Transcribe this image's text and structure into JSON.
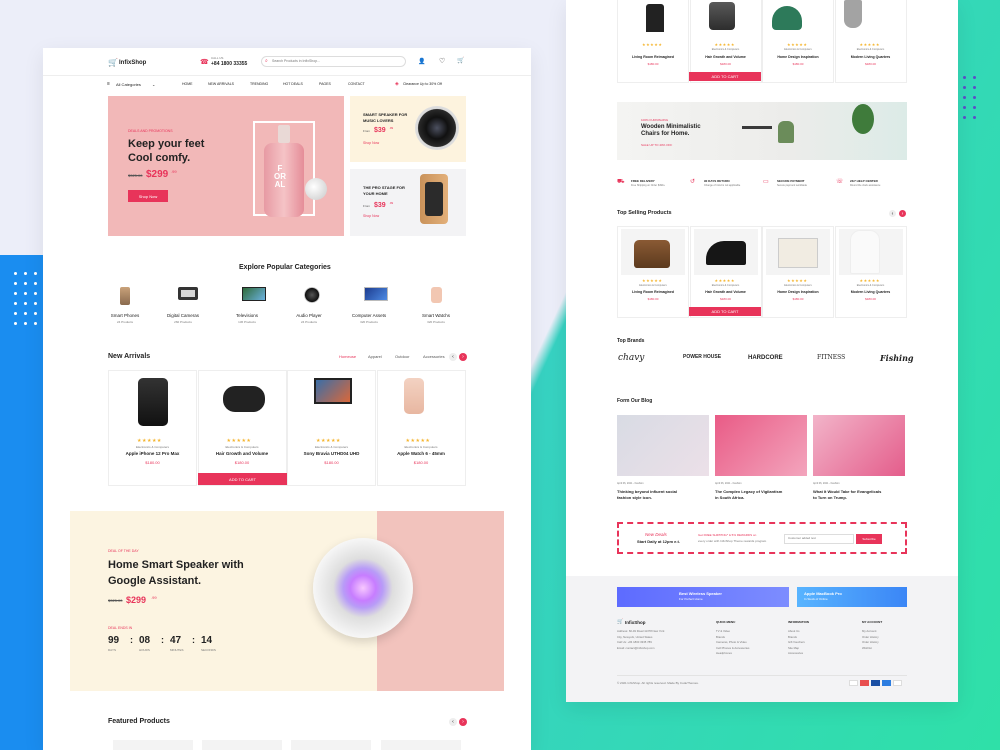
{
  "brand": "InfixShop",
  "header": {
    "call_label": "CALL US",
    "phone": "+84 1800 33355",
    "search_placeholder": "Search Products in InfixShop..."
  },
  "nav": {
    "categories": "All Categories",
    "items": [
      "HOME",
      "NEW ARRIVALS",
      "TRENDING",
      "HOT DEALS",
      "PAGES",
      "CONTACT"
    ],
    "promo": "Clearance Up to 30% Off"
  },
  "hero": {
    "kicker": "DEALS AND PROMOTIONS",
    "title1": "Keep your feet",
    "title2": "Cool comfy.",
    "old_price": "$325.00",
    "price": "$299",
    "cents": ".99",
    "cta": "Shop Now",
    "bottle_text": "F\nOR\nAL"
  },
  "side_banners": [
    {
      "title1": "SMART SPEAKER FOR",
      "title2": "MUSIC LOVERS",
      "from": "From",
      "price": "$39",
      "cents": ".99",
      "cta": "Shop Now"
    },
    {
      "title1": "THE PRO STAGE FOR",
      "title2": "YOUR HOME",
      "from": "From",
      "price": "$39",
      "cents": ".99",
      "cta": "Shop Now"
    }
  ],
  "categories": {
    "title": "Explore Popular Categories",
    "items": [
      {
        "name": "Smart Phones",
        "count": "24 Products",
        "icon": "phone-icon"
      },
      {
        "name": "Digital Cameras",
        "count": "260 Products",
        "icon": "camera-icon"
      },
      {
        "name": "Televisions",
        "count": "136 Products",
        "icon": "tv-icon"
      },
      {
        "name": "Audio Player",
        "count": "24 Products",
        "icon": "speaker-icon"
      },
      {
        "name": "Computer Assets",
        "count": "320 Products",
        "icon": "laptop-icon"
      },
      {
        "name": "Smart Watchs",
        "count": "320 Products",
        "icon": "watch-icon"
      }
    ]
  },
  "new_arrivals": {
    "title": "New Arrivals",
    "tabs": [
      "Homeuse",
      "Apparel",
      "Outdoor",
      "Accessories"
    ],
    "add_to_cart": "ADD TO CART",
    "items": [
      {
        "cat": "Electronics & Computers",
        "name": "Apple iPhone 12 Pro Max",
        "price": "$180.00",
        "icon": "iphone-image"
      },
      {
        "cat": "Electronics & Computers",
        "name": "Hair Growth and Volume",
        "price": "$180.00",
        "icon": "gamepad-image"
      },
      {
        "cat": "Electronics & Computers",
        "name": "Sony Bravia UTHD04 UHD",
        "price": "$180.00",
        "icon": "tv-image"
      },
      {
        "cat": "Electronics & Computers",
        "name": "Apple Watch 6 - 45mm",
        "price": "$180.00",
        "icon": "watch-image"
      }
    ]
  },
  "deal": {
    "kicker": "DEAL OF THE DAY",
    "title1": "Home Smart Speaker with",
    "title2": "Google Assistant.",
    "old_price": "$325.00",
    "price": "$299",
    "cents": ".99",
    "ends": "DEAL ENDS IN",
    "timer": [
      {
        "v": "99",
        "l": "DAYS"
      },
      {
        "v": "08",
        "l": "HOURS"
      },
      {
        "v": "47",
        "l": "MINUTES"
      },
      {
        "v": "14",
        "l": "SECONDS"
      }
    ]
  },
  "featured": {
    "title": "Featured Products"
  },
  "p2_top": {
    "add_to_cart": "ADD TO CART",
    "items": [
      {
        "cat": "",
        "name": "Living Room Reimagined",
        "price": "$180.00"
      },
      {
        "cat": "Electronics & Computers",
        "name": "Hair Growth and Volume",
        "price": "$180.00"
      },
      {
        "cat": "Electronics & Computers",
        "name": "Home Design Inspiration",
        "price": "$180.00"
      },
      {
        "cat": "Electronics & Computers",
        "name": "Modern Living Quarters",
        "price": "$180.00"
      }
    ]
  },
  "chairs": {
    "kicker": "100% FURNISHING",
    "title1": "Wooden Minimalistic",
    "title2": "Chairs for Home.",
    "sub": "SALE UP TO 40% OFF"
  },
  "features": [
    {
      "title": "FREE DELIVERY",
      "sub": "Free Shipping on Order $499+"
    },
    {
      "title": "90 DAYS RETURN",
      "sub": "Change of mind is not applicable"
    },
    {
      "title": "SECURE PAYMENT",
      "sub": "Secure payment worldwide"
    },
    {
      "title": "24/7 HELP CENTER",
      "sub": "Round the clock assistance"
    }
  ],
  "top_selling": {
    "title": "Top Selling Products",
    "add_to_cart": "ADD TO CART",
    "items": [
      {
        "cat": "Electronics & Computers",
        "name": "Living Room Reimagined",
        "price": "$180.00"
      },
      {
        "cat": "Electronics & Computers",
        "name": "Hair Growth and Volume",
        "price": "$180.00"
      },
      {
        "cat": "Electronics & Computers",
        "name": "Home Design Inspiration",
        "price": "$180.00"
      },
      {
        "cat": "Electronics & Computers",
        "name": "Modern Living Quarters",
        "price": "$180.00"
      }
    ]
  },
  "brands": {
    "title": "Top Brands",
    "items": [
      "chavy",
      "POWER HOUSE",
      "HARDCORE",
      "FITNESS",
      "Fishing"
    ]
  },
  "blog": {
    "title": "Form Our Blog",
    "items": [
      {
        "date": "April 06, 2021 - Fashion",
        "t1": "Thinking beyond influent social",
        "t2": "fashion style icon."
      },
      {
        "date": "April 06, 2021 - Fashion",
        "t1": "The Complex Legacy of Vigilantism",
        "t2": "in South Africa."
      },
      {
        "date": "April 06, 2021 - Fashion",
        "t1": "What It Would Take for Evangelicals",
        "t2": "to Turn on Trump."
      }
    ]
  },
  "newsletter": {
    "kicker": "New Deals",
    "sub": "Start Daily at 12pm e.t.",
    "offer": "Get FREE SHIPPING* & 5% REWARDS on",
    "offer2": "every order with InfixShop Theme rewards program",
    "placeholder": "Customer added text",
    "cta": "Subscribe"
  },
  "promos": [
    {
      "t1": "Best Wireless Speaker",
      "t2": "For Perfect Home"
    },
    {
      "t1": "Apple MacBook Pro",
      "t2": "In Stock of Online"
    }
  ],
  "footer": {
    "brand": "InfixShop",
    "address": [
      "Address: 60-49 Road 11378 New York",
      "City, Newyork, United States",
      "Call Us: +84 1800 3335 789",
      "Email: contact@infixshop.com"
    ],
    "cols": [
      {
        "title": "QUICK MENU",
        "items": [
          "TV & Video",
          "Brands",
          "Cameras, Photo & Video",
          "Cell Phones & Accessories",
          "Headphones"
        ]
      },
      {
        "title": "INFORMATION",
        "items": [
          "About Us",
          "Brands",
          "Gift Vouchers",
          "Site Map",
          "Accessories"
        ]
      },
      {
        "title": "MY ACCOUNT",
        "items": [
          "My Account",
          "Order History",
          "Order History",
          "Wishlist"
        ]
      }
    ],
    "copyright": "© 2021 InfixShop. All rights reserved. Made By CodeThemes."
  }
}
